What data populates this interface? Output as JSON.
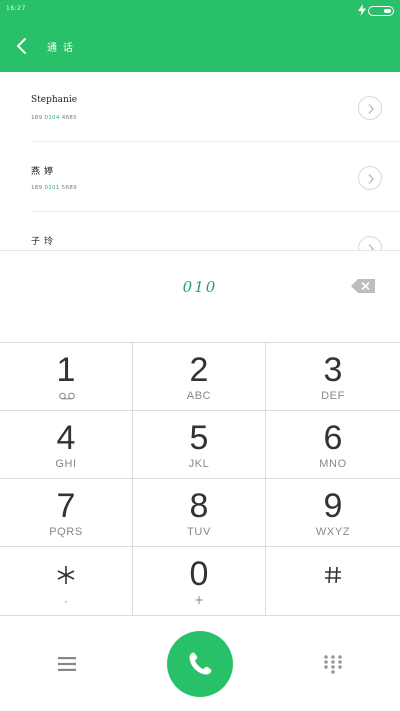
{
  "status_bar": {
    "time": "16:27"
  },
  "header": {
    "title": "通话"
  },
  "contacts": [
    {
      "name": "Stephanie",
      "number_prefix": "189 ",
      "number_match": "0104",
      "number_suffix": " 4685"
    },
    {
      "name": "燕婷",
      "number_prefix": "189 ",
      "number_match": "0101",
      "number_suffix": " 5689"
    },
    {
      "name": "子玲",
      "number_prefix": "",
      "number_match": "",
      "number_suffix": ""
    }
  ],
  "dialer": {
    "dialed_number": "010"
  },
  "keypad": [
    {
      "digit": "1",
      "letters": ""
    },
    {
      "digit": "2",
      "letters": "ABC"
    },
    {
      "digit": "3",
      "letters": "DEF"
    },
    {
      "digit": "4",
      "letters": "GHI"
    },
    {
      "digit": "5",
      "letters": "JKL"
    },
    {
      "digit": "6",
      "letters": "MNO"
    },
    {
      "digit": "7",
      "letters": "PQRS"
    },
    {
      "digit": "8",
      "letters": "TUV"
    },
    {
      "digit": "9",
      "letters": "WXYZ"
    },
    {
      "digit": "",
      "sub": ","
    },
    {
      "digit": "0",
      "sub": "+"
    },
    {
      "digit": "",
      "sub": ""
    }
  ],
  "icons": {
    "back": "chevron-left-icon",
    "backspace": "backspace-icon",
    "voicemail": "voicemail-icon",
    "star": "asterisk-icon",
    "hash": "hash-icon",
    "menu": "menu-icon",
    "call": "phone-icon",
    "dialpad": "dialpad-icon"
  },
  "colors": {
    "accent": "#29c06a",
    "match_text": "#29b06a"
  }
}
